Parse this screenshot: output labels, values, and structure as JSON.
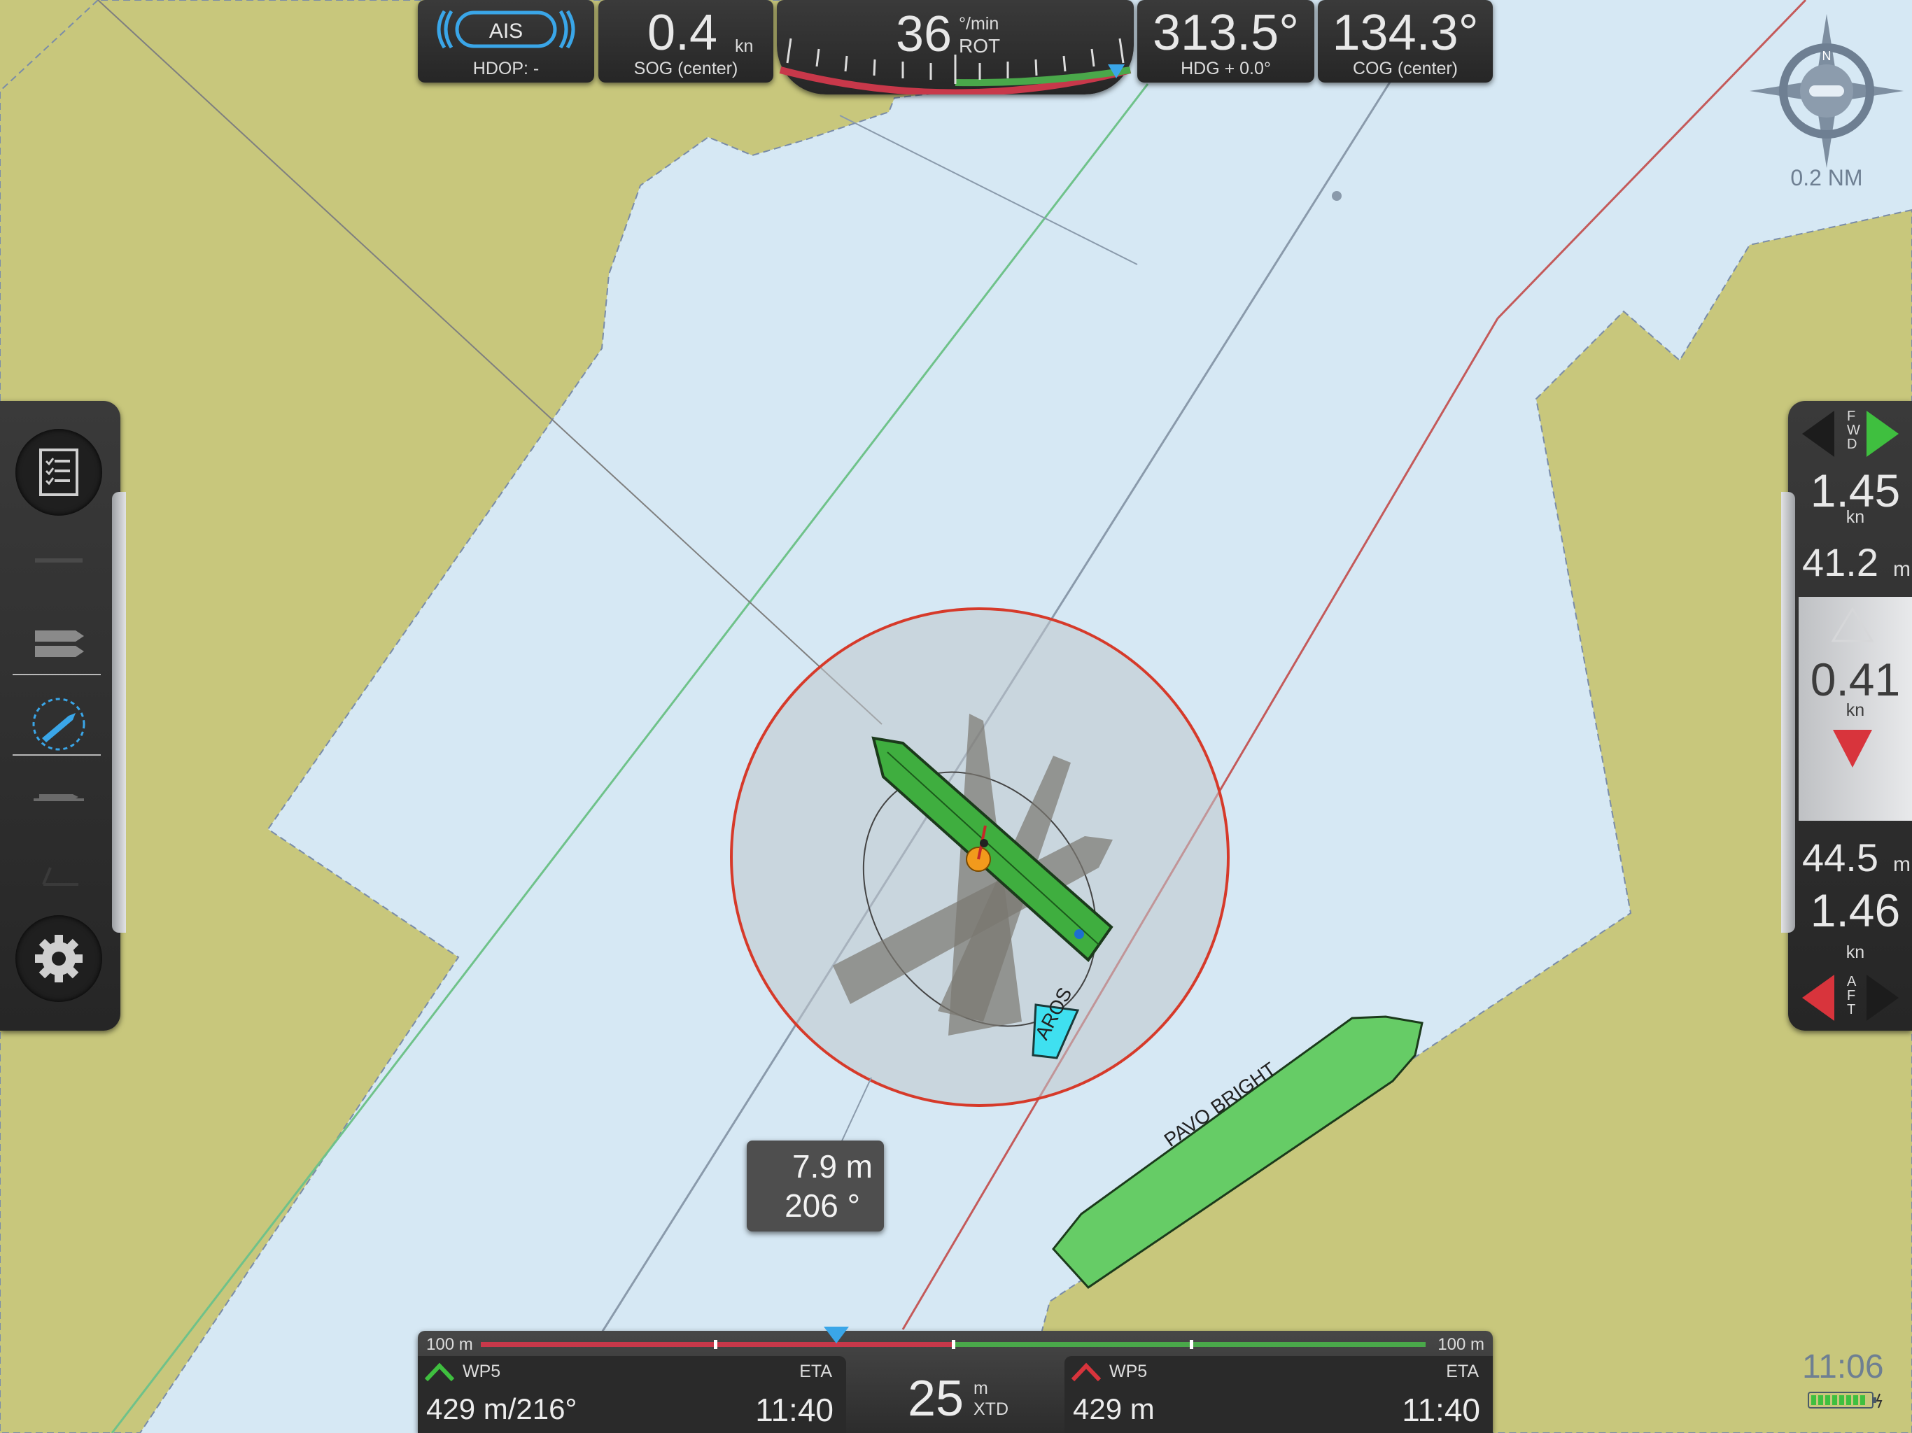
{
  "top_bar": {
    "ais": {
      "label": "AIS",
      "hdop_label": "HDOP: -"
    },
    "sog": {
      "value": "0.4",
      "unit": "kn",
      "label": "SOG (center)"
    },
    "rot": {
      "value": "36",
      "unit": "°/min",
      "label": "ROT",
      "level_fraction": 0.95
    },
    "hdg": {
      "value": "313.5°",
      "label": "HDG + 0.0°"
    },
    "cog": {
      "value": "134.3°",
      "label": "COG (center)"
    }
  },
  "compass": {
    "scale_label": "0.2 NM",
    "north_label": "N"
  },
  "left_toolbar": {
    "items": [
      {
        "name": "checklist",
        "icon": "checklist-icon"
      },
      {
        "name": "layer",
        "icon": "layer-flat-icon"
      },
      {
        "name": "multi-vessel",
        "icon": "vessels-icon"
      },
      {
        "name": "vessel-rotate",
        "icon": "vessel-rotate-icon",
        "active": true
      },
      {
        "name": "vessel-profile",
        "icon": "vessel-side-icon"
      },
      {
        "name": "measure",
        "icon": "measure-icon"
      },
      {
        "name": "settings",
        "icon": "gear-icon"
      }
    ]
  },
  "right_panel": {
    "fwd_label": "FWD",
    "fwd_speed": "1.45",
    "fwd_speed_unit": "kn",
    "fwd_distance": "41.2",
    "fwd_distance_unit": "m",
    "mid_speed": "0.41",
    "mid_speed_unit": "kn",
    "aft_distance": "44.5",
    "aft_distance_unit": "m",
    "aft_speed": "1.46",
    "aft_speed_unit": "kn",
    "aft_label": "AFT"
  },
  "vessels": [
    {
      "name": "AROS",
      "color": "#3fe0f0"
    },
    {
      "name": "PAVO BRIGHT",
      "color": "#66cc66"
    }
  ],
  "measurement": {
    "distance": "7.9 m",
    "bearing": "206 °"
  },
  "bottom_bar": {
    "xtd_left_label": "100 m",
    "xtd_right_label": "100 m",
    "xtd_value": "25",
    "xtd_unit": "m",
    "xtd_label": "XTD",
    "left_wp": {
      "name": "WP5",
      "eta_label": "ETA",
      "distance": "429 m/216°",
      "eta": "11:40"
    },
    "right_wp": {
      "name": "WP5",
      "eta_label": "ETA",
      "distance": "429 m",
      "eta": "11:40"
    }
  },
  "status": {
    "time": "11:06"
  },
  "colors": {
    "land": "#c8c77c",
    "water": "#d6e8f4",
    "own_ship": "#3fae3f",
    "danger": "#d63a2a"
  }
}
